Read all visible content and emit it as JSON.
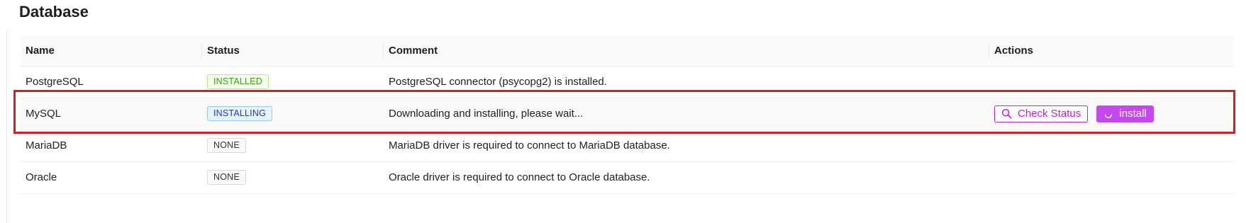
{
  "section": {
    "title": "Database"
  },
  "table": {
    "headers": {
      "name": "Name",
      "status": "Status",
      "comment": "Comment",
      "actions": "Actions"
    },
    "rows": [
      {
        "name": "PostgreSQL",
        "status": "INSTALLED",
        "comment": "PostgreSQL connector (psycopg2) is installed."
      },
      {
        "name": "MySQL",
        "status": "INSTALLING",
        "comment": "Downloading and installing, please wait...",
        "actions": {
          "check_status_label": "Check Status",
          "check_status_icon": "search-icon",
          "install_label": "install",
          "install_icon": "loading-spinner-icon"
        }
      },
      {
        "name": "MariaDB",
        "status": "NONE",
        "comment": "MariaDB driver is required to connect to MariaDB database."
      },
      {
        "name": "Oracle",
        "status": "NONE",
        "comment": "Oracle driver is required to connect to Oracle database."
      }
    ]
  },
  "colors": {
    "accent": "#c41de0",
    "accent_fill": "#c548ee",
    "installed": "#389e0d",
    "installing": "#1d39c4",
    "highlight_border": "#e01b1b"
  }
}
